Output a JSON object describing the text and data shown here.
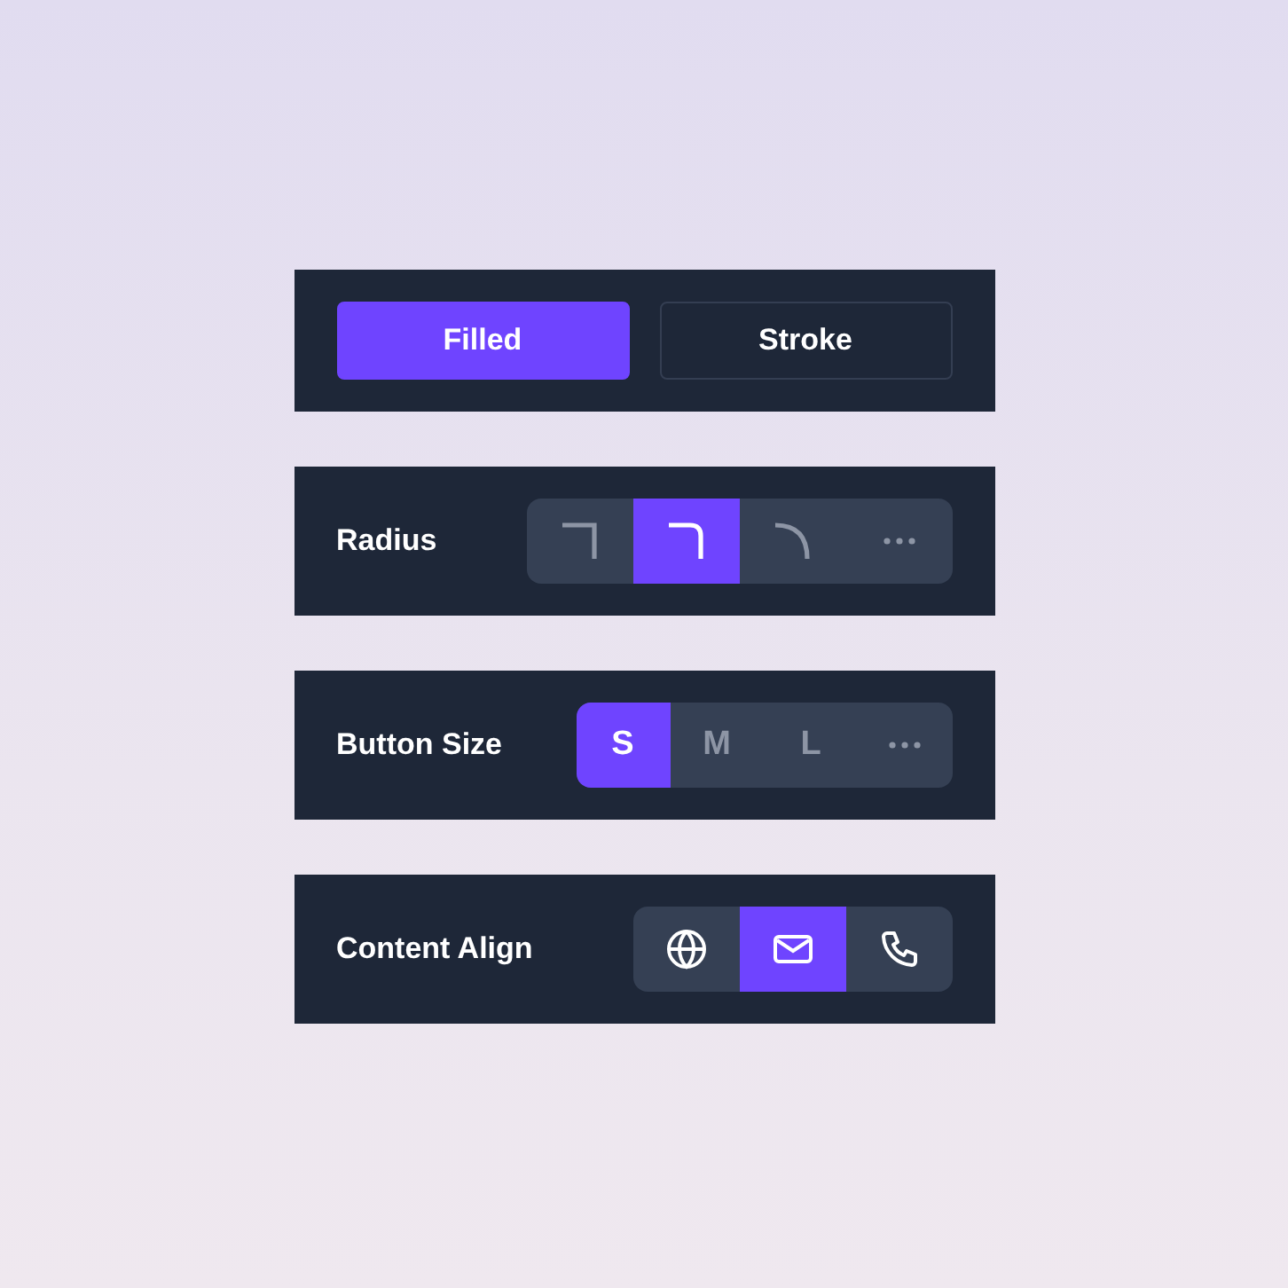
{
  "style_buttons": [
    {
      "label": "Filled",
      "selected": true
    },
    {
      "label": "Stroke",
      "selected": false
    }
  ],
  "rows": [
    {
      "label": "Radius",
      "options": [
        {
          "kind": "corner-sharp",
          "selected": false
        },
        {
          "kind": "corner-rounded",
          "selected": true
        },
        {
          "kind": "corner-round",
          "selected": false
        },
        {
          "kind": "more",
          "selected": false
        }
      ]
    },
    {
      "label": "Button Size",
      "options": [
        {
          "kind": "text",
          "text": "S",
          "selected": true
        },
        {
          "kind": "text",
          "text": "M",
          "selected": false
        },
        {
          "kind": "text",
          "text": "L",
          "selected": false
        },
        {
          "kind": "more",
          "selected": false
        }
      ]
    },
    {
      "label": "Content Align",
      "options": [
        {
          "kind": "globe",
          "selected": false
        },
        {
          "kind": "mail",
          "selected": true
        },
        {
          "kind": "phone",
          "selected": false
        }
      ]
    }
  ]
}
